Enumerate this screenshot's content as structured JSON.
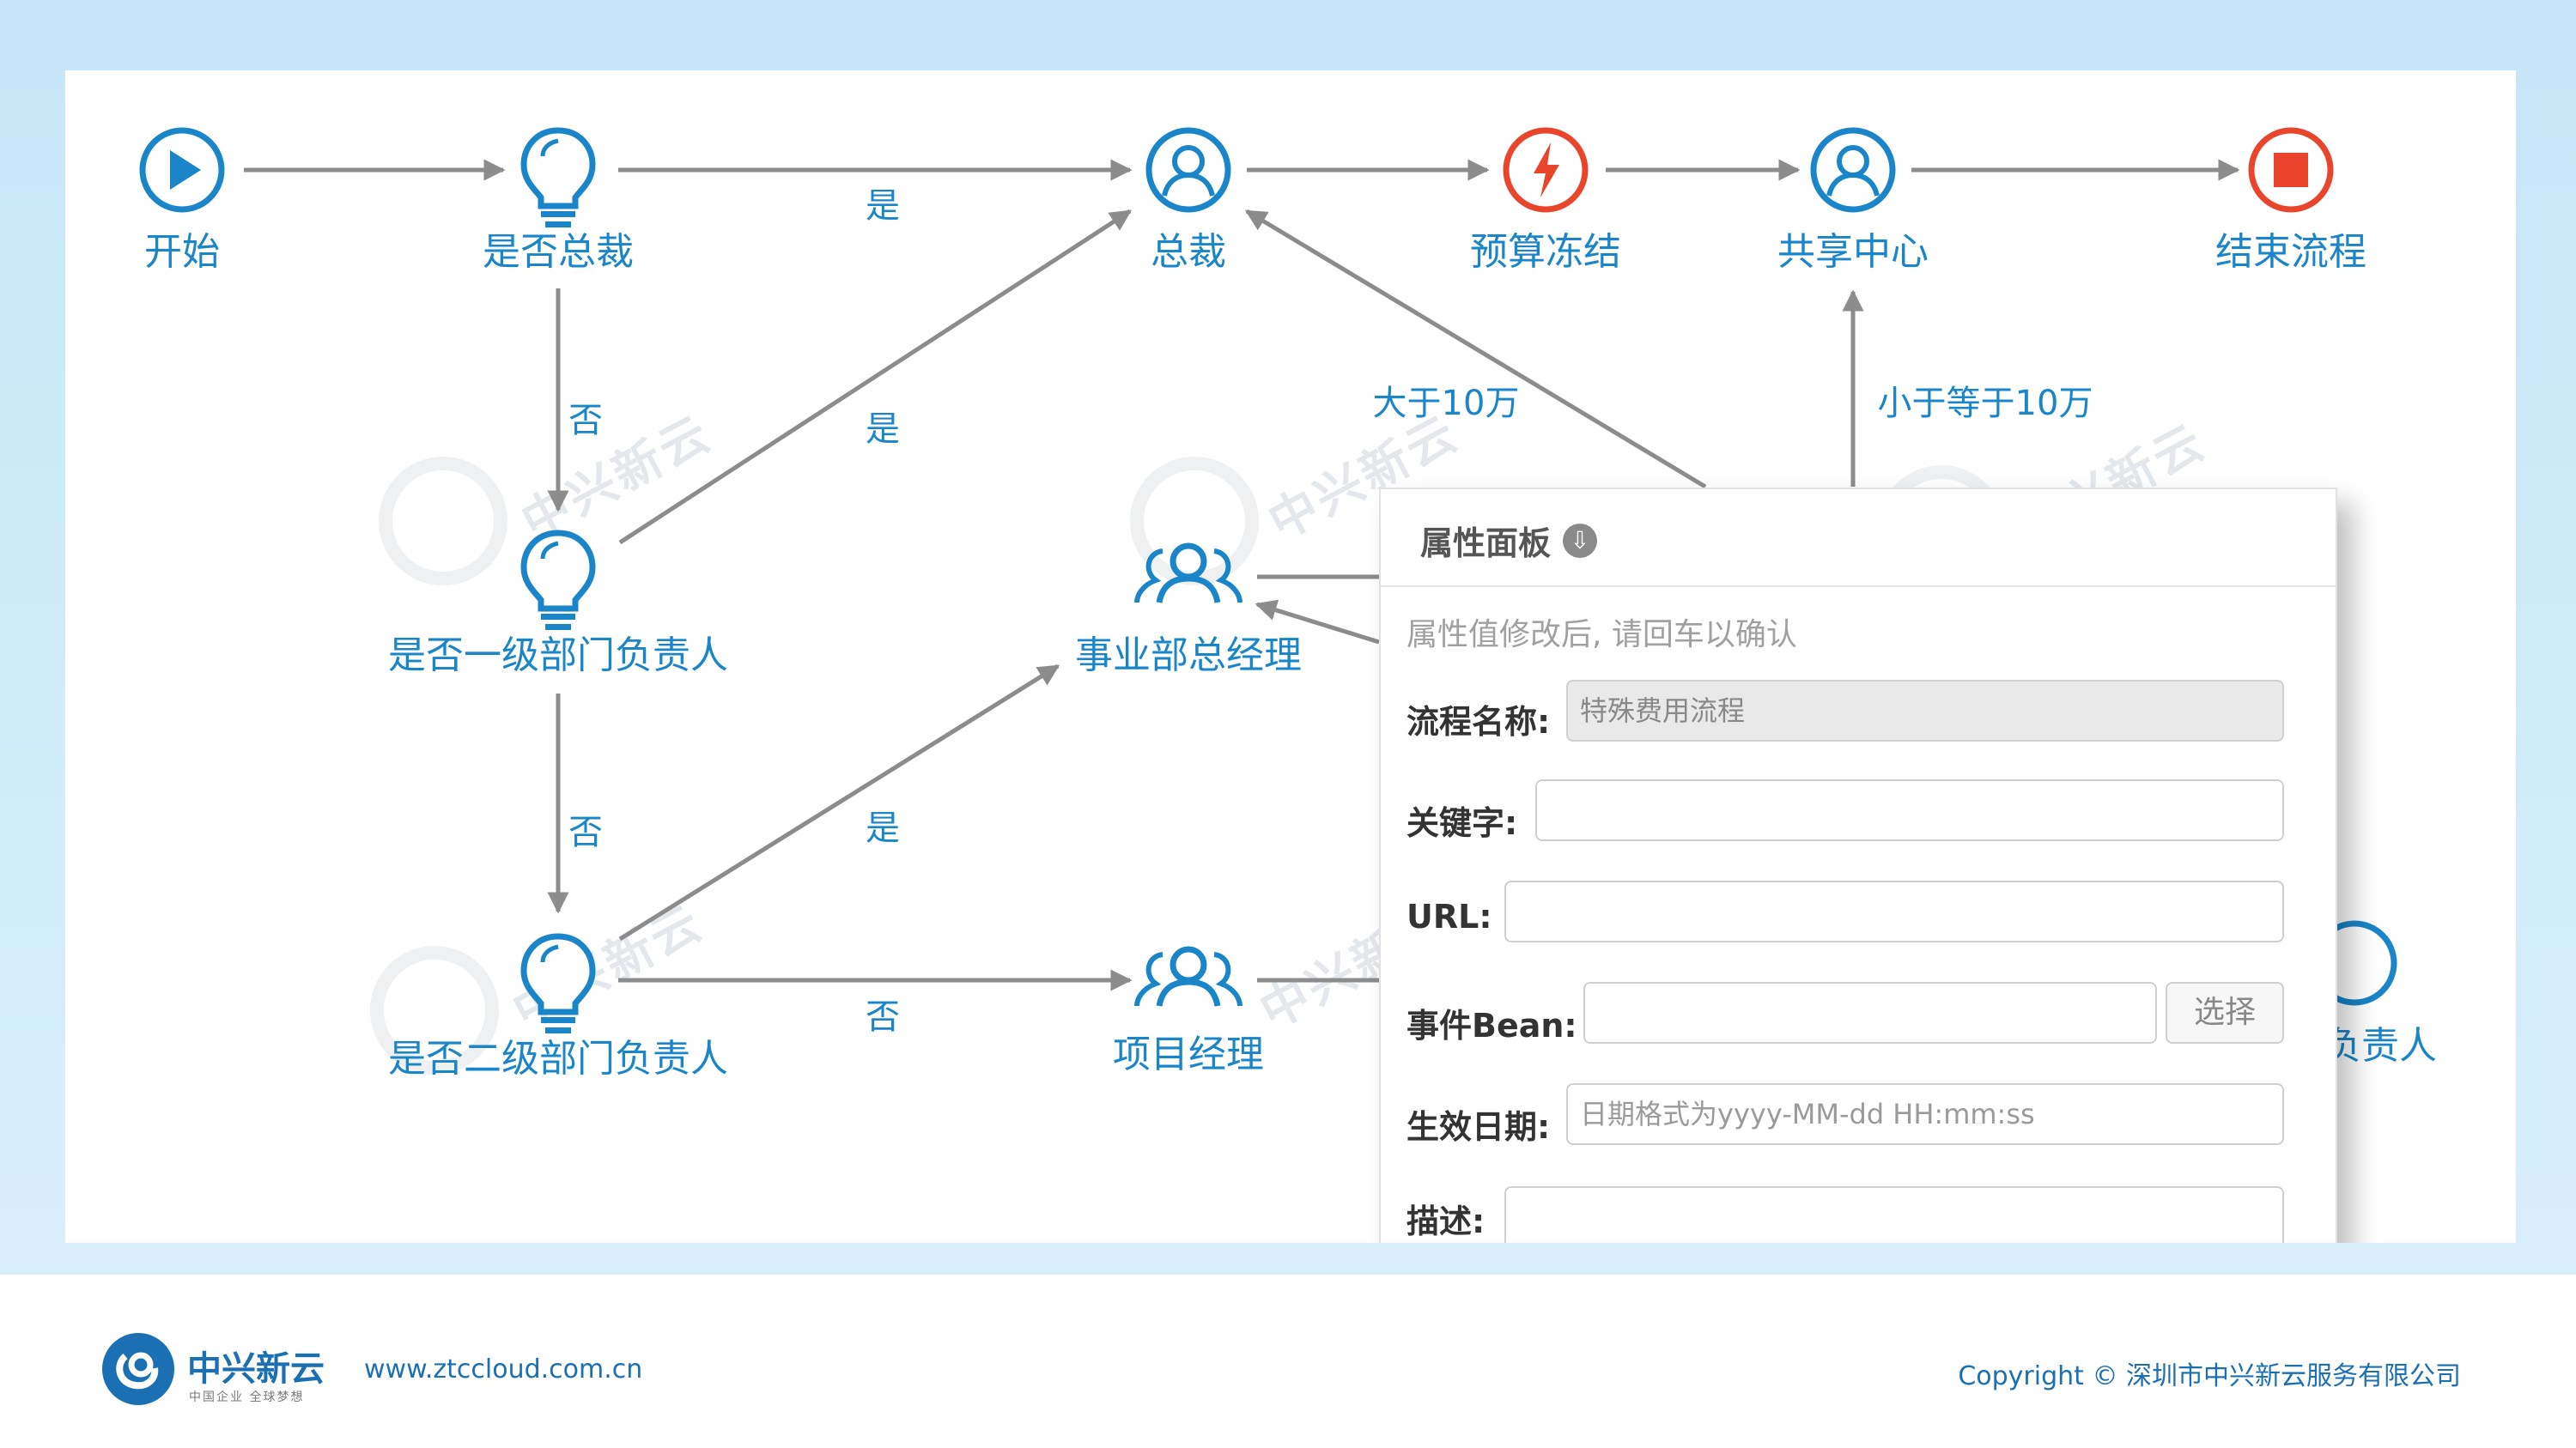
{
  "nodes": {
    "start": "开始",
    "is_president": "是否总裁",
    "president": "总裁",
    "budget_freeze": "预算冻结",
    "shared_center": "共享中心",
    "end_flow": "结束流程",
    "is_level1_head": "是否一级部门负责人",
    "division_gm": "事业部总经理",
    "is_level2_head": "是否二级部门负责人",
    "project_manager": "项目经理",
    "partial_head": "负责人"
  },
  "edges": {
    "yes_top": "是",
    "no_1": "否",
    "yes_mid": "是",
    "no_2": "否",
    "yes_low": "是",
    "no_low": "否",
    "gt_100k": "大于10万",
    "le_100k": "小于等于10万"
  },
  "watermark": {
    "text": "中兴新云"
  },
  "panel": {
    "title": "属性面板",
    "toggle_icon": "collapse-down-icon",
    "hint": "属性值修改后, 请回车以确认",
    "fields": {
      "flow_name_label": "流程名称:",
      "flow_name_value": "特殊费用流程",
      "keyword_label": "关键字:",
      "keyword_value": "",
      "url_label": "URL:",
      "url_value": "",
      "event_bean_label": "事件Bean:",
      "event_bean_value": "",
      "select_button": "选择",
      "effective_date_label": "生效日期:",
      "effective_date_placeholder": "日期格式为yyyy-MM-dd HH:mm:ss",
      "description_label": "描述:",
      "description_value": ""
    }
  },
  "footer": {
    "brand": "中兴新云",
    "tagline": "中国企业 全球梦想",
    "url": "www.ztccloud.com.cn",
    "copyright": "Copyright © 深圳市中兴新云服务有限公司"
  },
  "colors": {
    "accent": "#1a85c8",
    "red": "#e8452c",
    "arrow": "#8c8c8c",
    "frame": "#c6e6f7"
  }
}
